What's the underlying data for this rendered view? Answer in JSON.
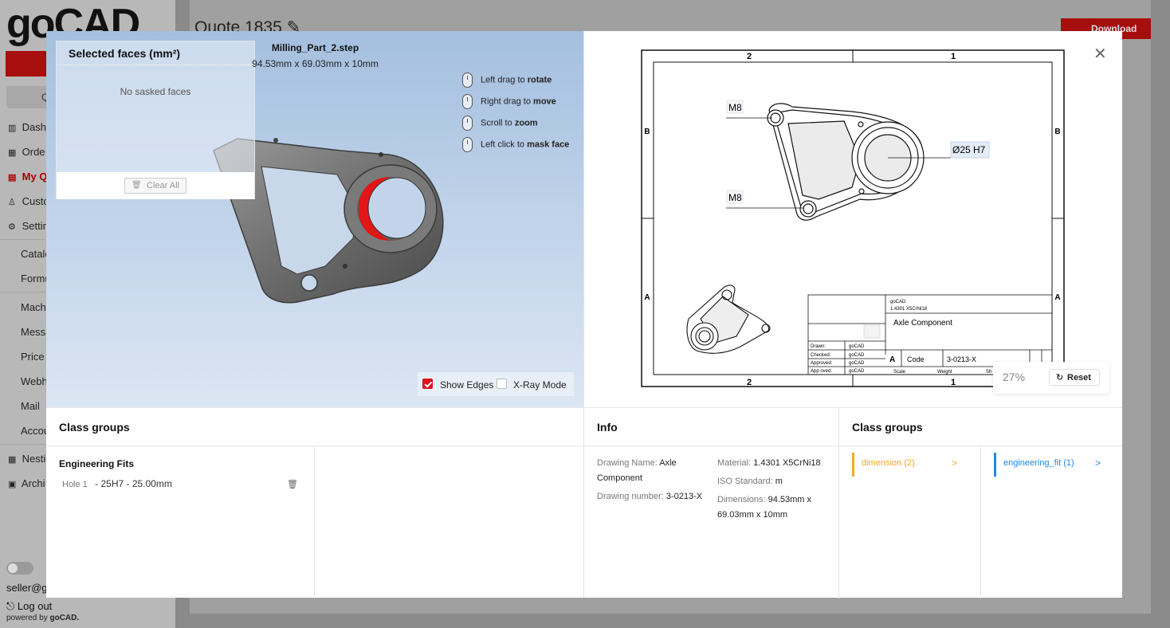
{
  "app": {
    "logo": "goCAD",
    "search_label": "Q",
    "nav": [
      {
        "label": "Dash",
        "icon": "chart-icon"
      },
      {
        "label": "Orde",
        "icon": "grid-icon"
      },
      {
        "label": "My Q",
        "icon": "doc-icon",
        "active": true
      },
      {
        "label": "Custo",
        "icon": "user-icon"
      },
      {
        "label": "Settin",
        "icon": "gear-icon"
      }
    ],
    "sub_nav": [
      "Catalo",
      "Formu",
      "Mach",
      "Messa",
      "Price",
      "Webh",
      "Mail",
      "Accou"
    ],
    "nav_bottom": [
      {
        "label": "Nesti",
        "icon": "grid-icon"
      },
      {
        "label": "Archi",
        "icon": "archive-icon"
      }
    ],
    "user_email": "seller@go",
    "logout_label": "Log out",
    "powered_prefix": "powered by",
    "powered_brand": "goCAD.",
    "page_title": "Quote 1835",
    "download_label": "Download"
  },
  "viewer": {
    "faces_title": "Selected faces (mm²)",
    "faces_empty": "No sasked faces",
    "clear_all": "Clear All",
    "file_name": "Milling_Part_2.step",
    "file_dims": "94.53mm x 69.03mm x 10mm",
    "hints": [
      {
        "prefix": "Left drag to",
        "action": "rotate"
      },
      {
        "prefix": "Right drag to",
        "action": "move"
      },
      {
        "prefix": "Scroll to",
        "action": "zoom"
      },
      {
        "prefix": "Left click to",
        "action": "mask face"
      }
    ],
    "show_edges_label": "Show Edges",
    "show_edges_checked": true,
    "xray_label": "X-Ray Mode",
    "xray_checked": false
  },
  "drawing": {
    "zoom": "27%",
    "reset_label": "Reset",
    "col_labels": [
      "2",
      "1"
    ],
    "row_labels": [
      "B",
      "A"
    ],
    "callouts": [
      "M8",
      "M8",
      "Ø25 H7"
    ],
    "title_block": {
      "company": "goCAD",
      "material": "1.4301 X5CrNi18",
      "title": "Axle Component",
      "sheet_size": "A",
      "code_label": "Code",
      "code": "3-0213-X",
      "roles": [
        "Drawn:",
        "Checked:",
        "Approved:",
        "App oved:"
      ],
      "role_value": "goCAD",
      "scale_label": "Scale",
      "weight_label": "Weight",
      "sheet_label": "Sh"
    }
  },
  "bottom": {
    "class_groups_title": "Class groups",
    "fits_title": "Engineering Fits",
    "fit_row": {
      "hole": "Hole 1",
      "value": "- 25H7 - 25.00mm"
    },
    "info_title": "Info",
    "info_left": [
      {
        "k": "Drawing Name:",
        "v": "Axle Component"
      },
      {
        "k": "Drawing number:",
        "v": "3-0213-X"
      }
    ],
    "info_right": [
      {
        "k": "Material:",
        "v": "1.4301 X5CrNi18"
      },
      {
        "k": "ISO Standard:",
        "v": "m"
      },
      {
        "k": "Dimensions:",
        "v": "94.53mm x 69.03mm x 10mm"
      }
    ],
    "class_groups_title_2": "Class groups",
    "tags": [
      {
        "label": "dimension (2)",
        "color": "#f5a623"
      },
      {
        "label": "engineering_fit (1)",
        "color": "#1e88e5"
      }
    ]
  }
}
